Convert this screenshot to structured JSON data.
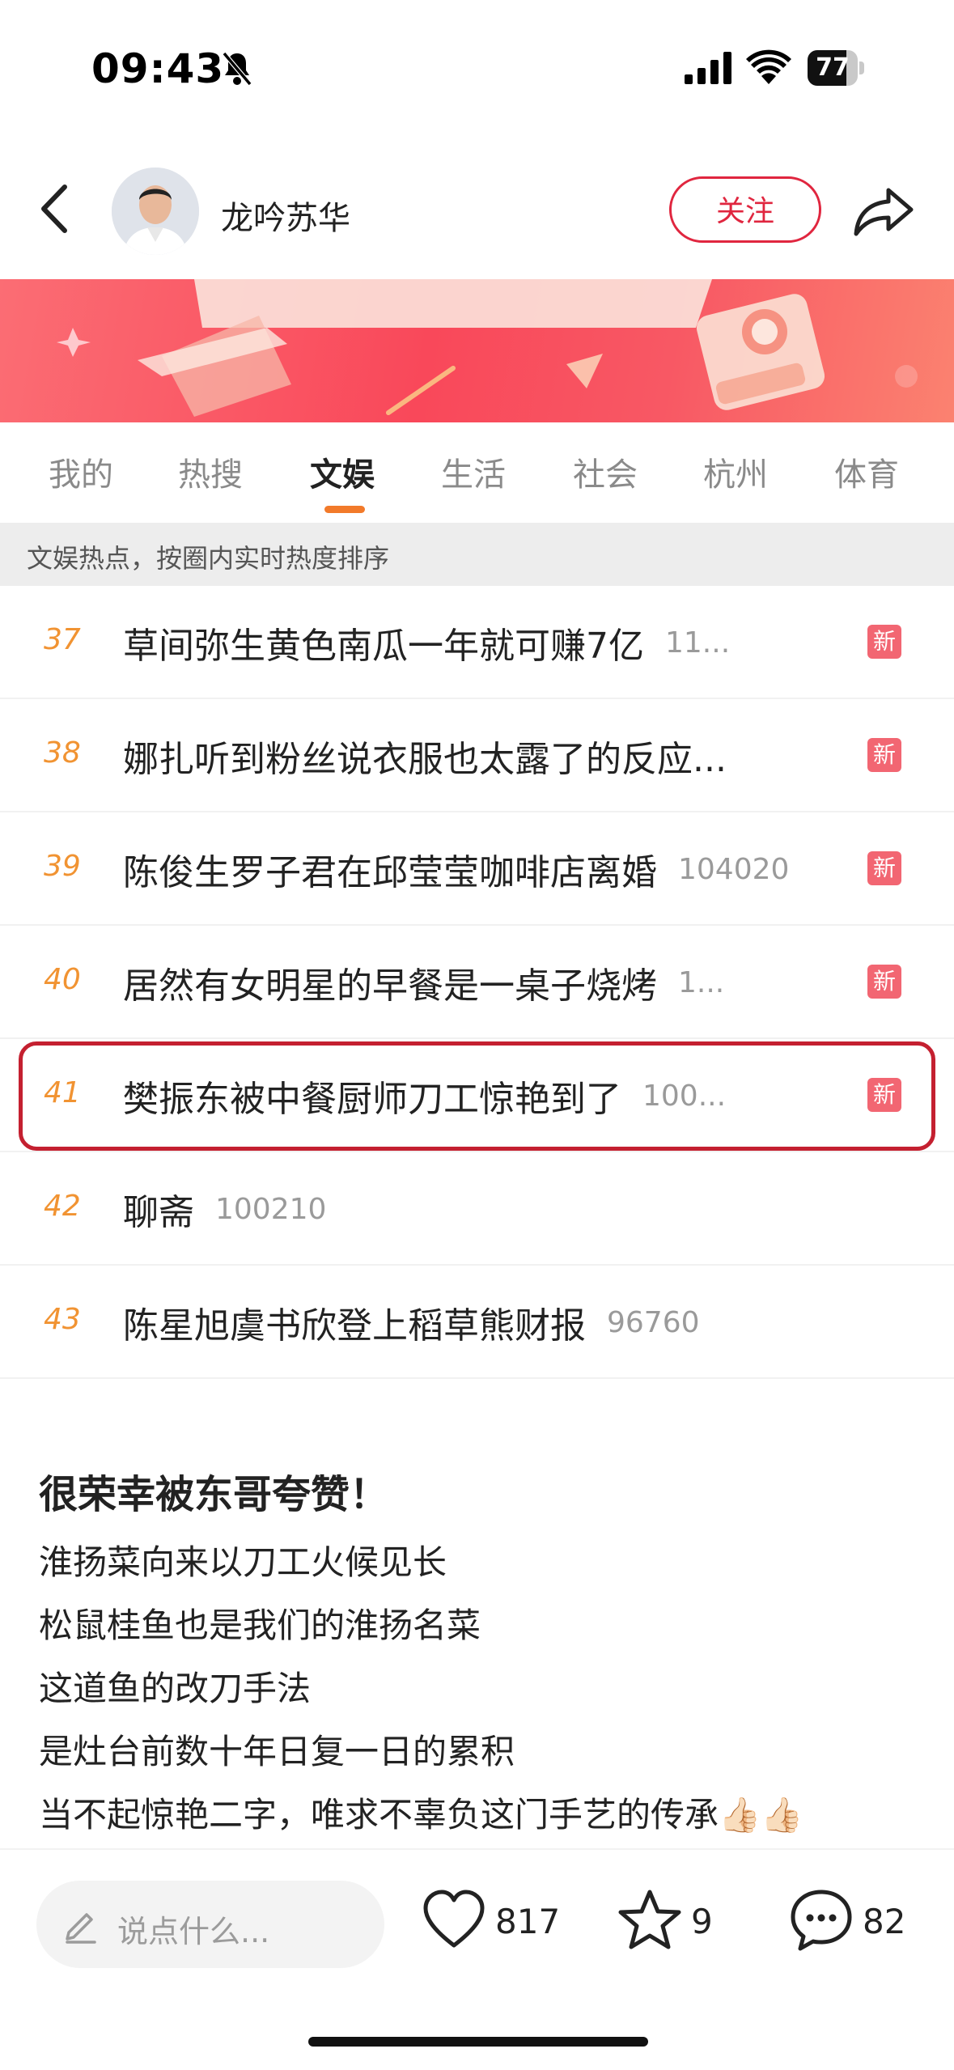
{
  "status_bar": {
    "time": "09:43",
    "battery": "77",
    "battery_level": 0.77
  },
  "nav": {
    "author_name": "龙吟苏华",
    "follow_label": "关注"
  },
  "tabs": [
    {
      "label": "我的"
    },
    {
      "label": "热搜"
    },
    {
      "label": "文娱",
      "active": true
    },
    {
      "label": "生活"
    },
    {
      "label": "社会"
    },
    {
      "label": "杭州"
    },
    {
      "label": "体育"
    }
  ],
  "hint": "文娱热点，按圈内实时热度排序",
  "hot_list": [
    {
      "rank": "37",
      "title": "草间弥生黄色南瓜一年就可赚7亿",
      "count": "11...",
      "badge": "新"
    },
    {
      "rank": "38",
      "title": "娜扎听到粉丝说衣服也太露了的反应...",
      "count": "",
      "badge": "新"
    },
    {
      "rank": "39",
      "title": "陈俊生罗子君在邱莹莹咖啡店离婚",
      "count": "104020",
      "badge": "新"
    },
    {
      "rank": "40",
      "title": "居然有女明星的早餐是一桌子烧烤",
      "count": "1...",
      "badge": "新"
    },
    {
      "rank": "41",
      "title": "樊振东被中餐厨师刀工惊艳到了",
      "count": "100...",
      "badge": "新",
      "highlighted": true
    },
    {
      "rank": "42",
      "title": "聊斋",
      "count": "100210",
      "badge": ""
    },
    {
      "rank": "43",
      "title": "陈星旭虞书欣登上稻草熊财报",
      "count": "96760",
      "badge": ""
    }
  ],
  "post": {
    "title": "很荣幸被东哥夸赞！",
    "lines": [
      "淮扬菜向来以刀工火候见长",
      "松鼠桂鱼也是我们的淮扬名菜",
      "这道鱼的改刀手法",
      "是灶台前数十年日复一日的累积",
      "当不起惊艳二字，唯求不辜负这门手艺的传承👍🏻👍🏻"
    ]
  },
  "bottom_bar": {
    "comment_placeholder": "说点什么...",
    "likes": "817",
    "favorites": "9",
    "comments": "82"
  },
  "colors": {
    "accent": "#e0263f",
    "rank": "#f19332",
    "badge": "#f26672",
    "tab_indicator": "#f27a2a"
  }
}
